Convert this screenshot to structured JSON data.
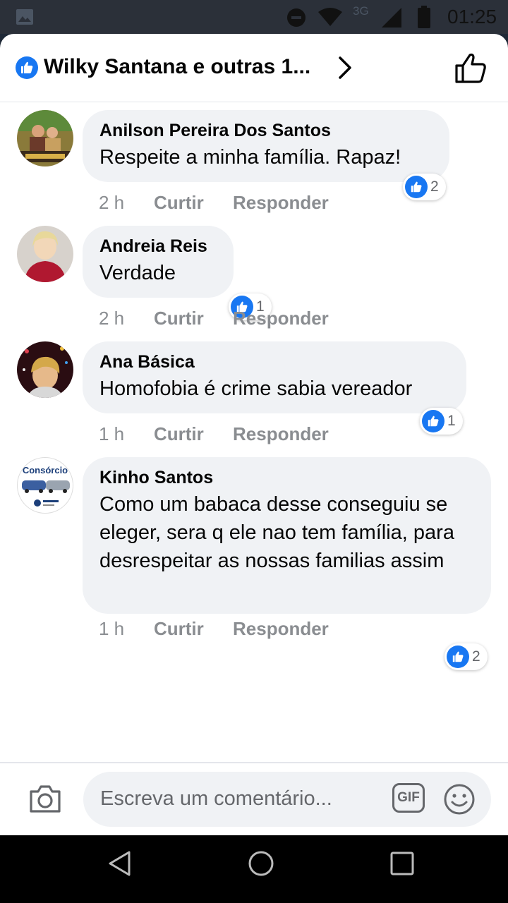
{
  "status_bar": {
    "network": "3G",
    "time": "01:25"
  },
  "header": {
    "title": "Wilky Santana e outras 1..."
  },
  "comments": [
    {
      "author": "Anilson Pereira Dos Santos",
      "text": "Respeite a minha família. Rapaz!",
      "time": "2 h",
      "like_label": "Curtir",
      "reply_label": "Responder",
      "reaction_count": "2"
    },
    {
      "author": "Andreia Reis",
      "text": "Verdade",
      "time": "2 h",
      "like_label": "Curtir",
      "reply_label": "Responder",
      "reaction_count": "1"
    },
    {
      "author": "Ana Básica",
      "text": "Homofobia é crime sabia vereador",
      "time": "1 h",
      "like_label": "Curtir",
      "reply_label": "Responder",
      "reaction_count": "1"
    },
    {
      "author": "Kinho Santos",
      "text": "Como um babaca desse conseguiu se eleger, sera q ele nao tem família, para desrespeitar as nossas familias assim",
      "time": "1 h",
      "like_label": "Curtir",
      "reply_label": "Responder",
      "reaction_count": "2",
      "avatar_text": "Consórcio"
    }
  ],
  "composer": {
    "placeholder": "Escreva um comentário...",
    "gif_label": "GIF"
  },
  "colors": {
    "accent": "#1877f2",
    "bubble": "#f0f2f5",
    "secondary_text": "#65676b"
  }
}
